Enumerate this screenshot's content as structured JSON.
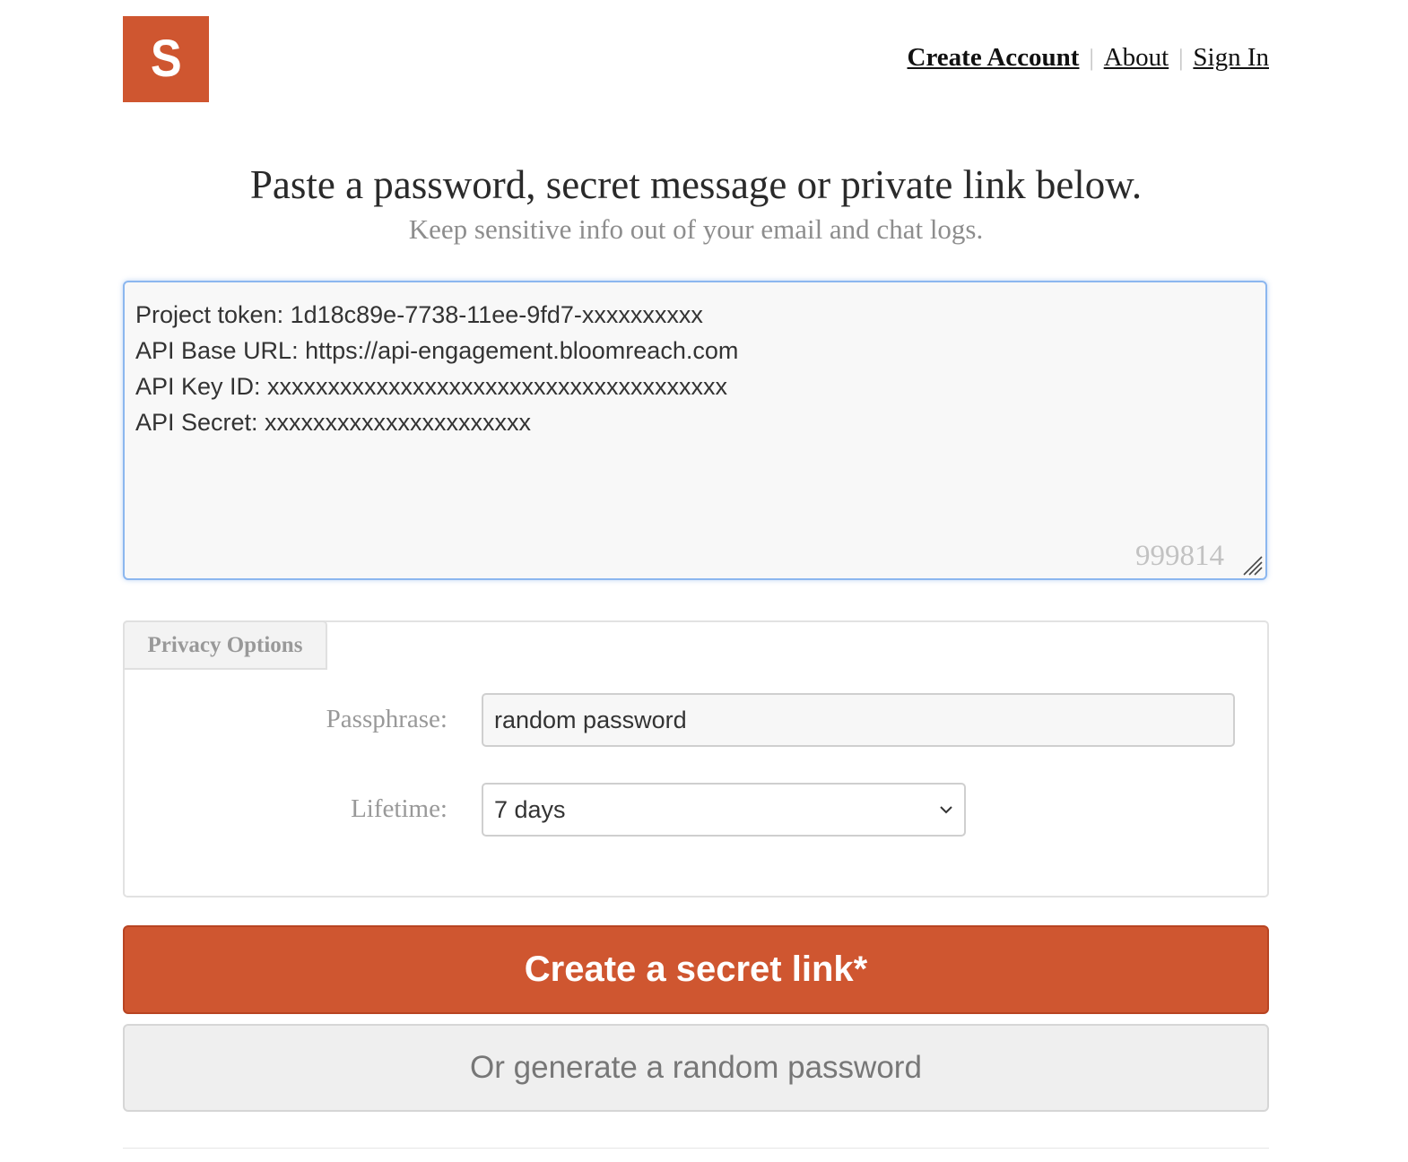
{
  "brand": {
    "logo_letter": "S",
    "color": "#cf5630"
  },
  "nav": {
    "create_account": "Create Account",
    "about": "About",
    "sign_in": "Sign In",
    "separator": "|"
  },
  "headline": "Paste a password, secret message or private link below.",
  "subheadline": "Keep sensitive info out of your email and chat logs.",
  "secret": {
    "value": "Project token: 1d18c89e-7738-11ee-9fd7-xxxxxxxxxx\nAPI Base URL: https://api-engagement.bloomreach.com\nAPI Key ID: xxxxxxxxxxxxxxxxxxxxxxxxxxxxxxxxxxxxxx\nAPI Secret: xxxxxxxxxxxxxxxxxxxxxx",
    "char_count": "999814",
    "border_color": "#8cb7ef"
  },
  "privacy": {
    "tab_label": "Privacy Options",
    "passphrase_label": "Passphrase:",
    "passphrase_value": "random password",
    "lifetime_label": "Lifetime:",
    "lifetime_value": "7 days"
  },
  "actions": {
    "create_label": "Create a secret link*",
    "generate_label": "Or generate a random password"
  }
}
